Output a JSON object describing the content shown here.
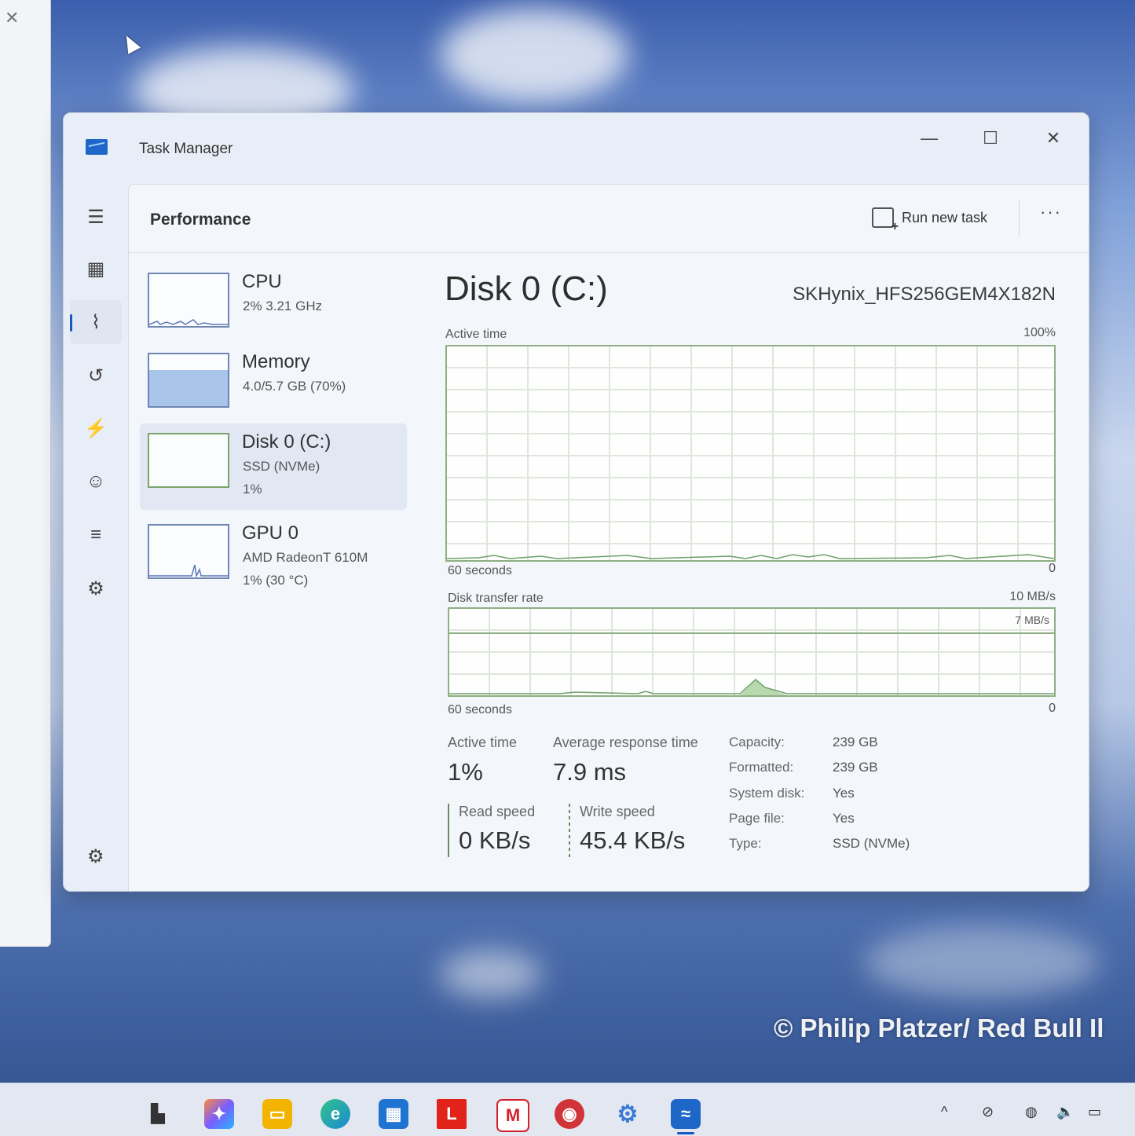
{
  "window": {
    "title": "Task Manager",
    "controls": {
      "minimize": "—",
      "maximize": "☐",
      "close": "✕"
    }
  },
  "header": {
    "page_title": "Performance",
    "run_new_task": "Run new task",
    "more": "···"
  },
  "nav": {
    "items": [
      {
        "name": "hamburger-menu-icon",
        "glyph": "☰"
      },
      {
        "name": "processes-icon",
        "glyph": "▦"
      },
      {
        "name": "performance-icon",
        "glyph": "⌇"
      },
      {
        "name": "app-history-icon",
        "glyph": "↺"
      },
      {
        "name": "startup-apps-icon",
        "glyph": "⚡"
      },
      {
        "name": "users-icon",
        "glyph": "☺"
      },
      {
        "name": "details-icon",
        "glyph": "≡"
      },
      {
        "name": "services-icon",
        "glyph": "⚙"
      }
    ],
    "settings_glyph": "⚙"
  },
  "resources": [
    {
      "name": "CPU",
      "line1": "2%  3.21 GHz",
      "line2": ""
    },
    {
      "name": "Memory",
      "line1": "4.0/5.7 GB (70%)",
      "line2": ""
    },
    {
      "name": "Disk 0 (C:)",
      "line1": "SSD (NVMe)",
      "line2": "1%"
    },
    {
      "name": "GPU 0",
      "line1": "AMD RadeonT 610M",
      "line2": "1%  (30 °C)"
    }
  ],
  "detail": {
    "title": "Disk 0 (C:)",
    "model": "SKHynix_HFS256GEM4X182N",
    "active_time_graph": {
      "label": "Active time",
      "max": "100%",
      "time": "60 seconds",
      "min": "0"
    },
    "transfer_graph": {
      "label": "Disk transfer rate",
      "max": "10 MB/s",
      "mid": "7 MB/s",
      "time": "60 seconds",
      "min": "0"
    },
    "stats": {
      "active_time_label": "Active time",
      "active_time_value": "1%",
      "avg_response_label": "Average response time",
      "avg_response_value": "7.9 ms",
      "read_label": "Read speed",
      "read_value": "0 KB/s",
      "write_label": "Write speed",
      "write_value": "45.4 KB/s"
    },
    "properties": [
      {
        "key": "Capacity:",
        "value": "239 GB"
      },
      {
        "key": "Formatted:",
        "value": "239 GB"
      },
      {
        "key": "System disk:",
        "value": "Yes"
      },
      {
        "key": "Page file:",
        "value": "Yes"
      },
      {
        "key": "Type:",
        "value": "SSD (NVMe)"
      }
    ]
  },
  "desktop": {
    "watermark": "© Philip Platzer/ Red Bull Il"
  },
  "taskbar": {
    "apps": [
      {
        "name": "start-icon",
        "glyph": "▙",
        "color": "#333333"
      },
      {
        "name": "copilot-icon",
        "glyph": "✦",
        "color": "#7b5cff"
      },
      {
        "name": "file-explorer-icon",
        "glyph": "▭",
        "color": "#f2b400"
      },
      {
        "name": "edge-icon",
        "glyph": "e",
        "color": "#1b8ad3"
      },
      {
        "name": "store-icon",
        "glyph": "▦",
        "color": "#1f73d1"
      },
      {
        "name": "lenovo-app-icon",
        "glyph": "L",
        "color": "#e2231a"
      },
      {
        "name": "mcafee-icon",
        "glyph": "M",
        "color": "#d4202a"
      },
      {
        "name": "office-icon",
        "glyph": "◉",
        "color": "#d13438"
      },
      {
        "name": "settings-app-icon",
        "glyph": "⚙",
        "color": "#3a7bd5"
      },
      {
        "name": "task-manager-taskbar-icon",
        "glyph": "≈",
        "color": "#1f66c9"
      }
    ],
    "tray": {
      "chevron": "^",
      "network": "⊘",
      "globe": "◍",
      "volume": "🔈",
      "battery": "▭"
    }
  }
}
